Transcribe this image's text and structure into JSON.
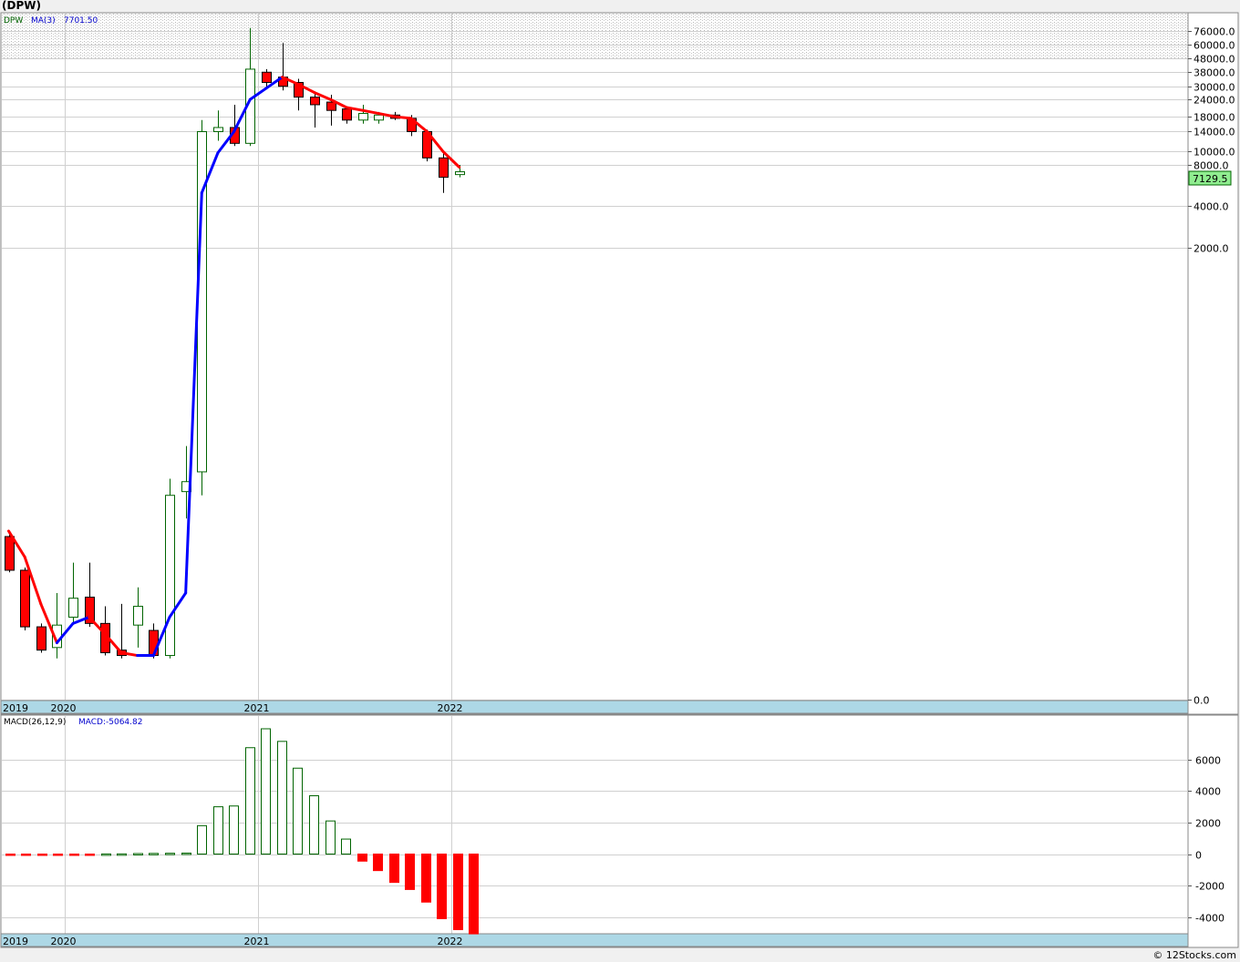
{
  "title": "(DPW)",
  "credit": "© 12Stocks.com",
  "colors": {
    "up": "#006400",
    "down": "#ff0000",
    "ma_up": "#0000ff",
    "ma_down": "#ff0000",
    "band": "#add8e6",
    "last_bg": "#90ee90"
  },
  "chart_data": [
    {
      "type": "candlestick",
      "legend": {
        "symbol": "DPW",
        "ma_label": "MA(3)",
        "ma_value": "7701.50"
      },
      "y_scale": "log",
      "y_ticks": [
        {
          "value": 76000,
          "label": "76000.0"
        },
        {
          "value": 60000,
          "label": "60000.0"
        },
        {
          "value": 48000,
          "label": "48000.0"
        },
        {
          "value": 38000,
          "label": "38000.0"
        },
        {
          "value": 30000,
          "label": "30000.0"
        },
        {
          "value": 24000,
          "label": "24000.0"
        },
        {
          "value": 18000,
          "label": "18000.0"
        },
        {
          "value": 14000,
          "label": "14000.0"
        },
        {
          "value": 10000,
          "label": "10000.0"
        },
        {
          "value": 8000,
          "label": "8000.0"
        },
        {
          "value": 4000,
          "label": "4000.0"
        },
        {
          "value": 2000,
          "label": "2000.0"
        },
        {
          "value": 0,
          "label": "0.0"
        }
      ],
      "last_price": "7129.5",
      "x_labels": [
        "2019",
        "2020",
        "2021",
        "2022"
      ],
      "candles": [
        {
          "o": 14.5,
          "h": 15.8,
          "l": 7.5,
          "c": 7.8
        },
        {
          "o": 7.8,
          "h": 8.2,
          "l": 2.2,
          "c": 2.4
        },
        {
          "o": 2.4,
          "h": 2.6,
          "l": 1.2,
          "c": 1.3
        },
        {
          "o": 1.4,
          "h": 5.0,
          "l": 1.0,
          "c": 2.5
        },
        {
          "o": 3.0,
          "h": 9.0,
          "l": 2.6,
          "c": 4.5
        },
        {
          "o": 4.6,
          "h": 9.0,
          "l": 2.4,
          "c": 2.6
        },
        {
          "o": 2.6,
          "h": 3.8,
          "l": 1.1,
          "c": 1.2
        },
        {
          "o": 1.3,
          "h": 4.0,
          "l": 1.0,
          "c": 1.1
        },
        {
          "o": 2.5,
          "h": 5.6,
          "l": 1.4,
          "c": 3.8
        },
        {
          "o": 2.2,
          "h": 2.6,
          "l": 1.0,
          "c": 1.1
        },
        {
          "o": 1.1,
          "h": 40.0,
          "l": 1.0,
          "c": 30.0
        },
        {
          "o": 32.0,
          "h": 70.0,
          "l": 20.0,
          "c": 38.0
        },
        {
          "o": 45.0,
          "h": 17000,
          "l": 30.0,
          "c": 14000
        },
        {
          "o": 14000,
          "h": 20000,
          "l": 12000,
          "c": 15000
        },
        {
          "o": 15000,
          "h": 22000,
          "l": 11000,
          "c": 11500
        },
        {
          "o": 11500,
          "h": 80000,
          "l": 11000,
          "c": 40000
        },
        {
          "o": 38000,
          "h": 40000,
          "l": 29000,
          "c": 32000
        },
        {
          "o": 35000,
          "h": 62000,
          "l": 28000,
          "c": 30000
        },
        {
          "o": 32000,
          "h": 34000,
          "l": 20000,
          "c": 25000
        },
        {
          "o": 25000,
          "h": 27000,
          "l": 15000,
          "c": 22000
        },
        {
          "o": 23000,
          "h": 26000,
          "l": 15500,
          "c": 20000
        },
        {
          "o": 20500,
          "h": 21500,
          "l": 16000,
          "c": 17000
        },
        {
          "o": 17000,
          "h": 22000,
          "l": 16000,
          "c": 19000
        },
        {
          "o": 17000,
          "h": 19500,
          "l": 16000,
          "c": 18500
        },
        {
          "o": 18500,
          "h": 19500,
          "l": 17000,
          "c": 17500
        },
        {
          "o": 17500,
          "h": 18500,
          "l": 13000,
          "c": 14000
        },
        {
          "o": 14000,
          "h": 14500,
          "l": 8500,
          "c": 9000
        },
        {
          "o": 9000,
          "h": 9800,
          "l": 5000,
          "c": 6500
        },
        {
          "o": 6800,
          "h": 8000,
          "l": 6500,
          "c": 7129.5
        }
      ],
      "ma": [
        16.0,
        10.0,
        4.0,
        1.6,
        2.6,
        3.0,
        2.0,
        1.2,
        1.1,
        1.1,
        3.0,
        5.0,
        5000,
        9800,
        14000,
        24000,
        29000,
        35000,
        31000,
        27000,
        24000,
        21000,
        20000,
        19000,
        18000,
        17500,
        14000,
        10000,
        7701.5
      ]
    },
    {
      "type": "bar",
      "legend": {
        "label": "MACD(26,12,9)",
        "value_label": "MACD:-5064.82"
      },
      "y_ticks": [
        {
          "value": 6000,
          "label": "6000"
        },
        {
          "value": 4000,
          "label": "4000"
        },
        {
          "value": 2000,
          "label": "2000"
        },
        {
          "value": 0,
          "label": "0"
        },
        {
          "value": -2000,
          "label": "-2000"
        },
        {
          "value": -4000,
          "label": "-4000"
        }
      ],
      "x_labels": [
        "2019",
        "2020",
        "2021",
        "2022"
      ],
      "values": [
        -40,
        -30,
        -20,
        -10,
        -10,
        -5,
        5,
        10,
        30,
        40,
        50,
        60,
        1800,
        3000,
        3050,
        6750,
        7950,
        7150,
        5450,
        3700,
        2100,
        950,
        -450,
        -1050,
        -1800,
        -2250,
        -3050,
        -4100,
        -4800,
        -5064.82
      ]
    }
  ]
}
